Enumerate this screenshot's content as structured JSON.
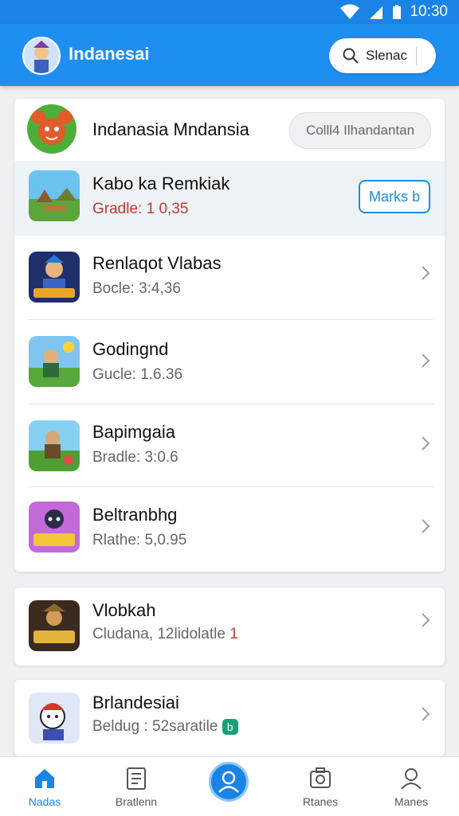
{
  "status_bar": {
    "time": "10:30",
    "icons": [
      "wifi-icon",
      "signal-icon",
      "battery-icon"
    ]
  },
  "app_bar": {
    "title": "Indanesai",
    "search_label": "Slenac"
  },
  "card1": {
    "header": {
      "title": "Indanasia Mndansia",
      "button_label": "Colll4 Ilhandantan"
    },
    "featured": {
      "title": "Kabo ka Remkiak",
      "sub_prefix": "Gradle: ",
      "sub_value": "1 0,35",
      "button_label": "Marks b"
    },
    "items": [
      {
        "title": "Renlaqot Vlabas",
        "sub": "Bocle: 3:4,36"
      },
      {
        "title": "Godingnd",
        "sub": "Gucle: 1.6.36"
      },
      {
        "title": "Bapimgaia",
        "sub": "Bradle: 3:0.6"
      },
      {
        "title": "Beltranbhg",
        "sub": "Rlathe: 5,0.95"
      }
    ]
  },
  "card2": {
    "title": "Vlobkah",
    "sub_text": "Cludana, 12lidolatle",
    "sub_value": "1"
  },
  "card3": {
    "title": "Brlandesiai",
    "sub_text": "Beldug : 52saratile",
    "badge": "b"
  },
  "bottom_nav": [
    {
      "label": "Nadas",
      "icon": "home-icon",
      "active": true
    },
    {
      "label": "Bratlenn",
      "icon": "document-icon",
      "active": false
    },
    {
      "label": "",
      "icon": "profile-icon",
      "active": false
    },
    {
      "label": "Rtanes",
      "icon": "camera-frame-icon",
      "active": false
    },
    {
      "label": "Manes",
      "icon": "person-icon",
      "active": false
    }
  ],
  "colors": {
    "primary": "#1e8ff0",
    "accent": "#1a8ee0",
    "red": "#c0392b",
    "green": "#19a07a"
  }
}
